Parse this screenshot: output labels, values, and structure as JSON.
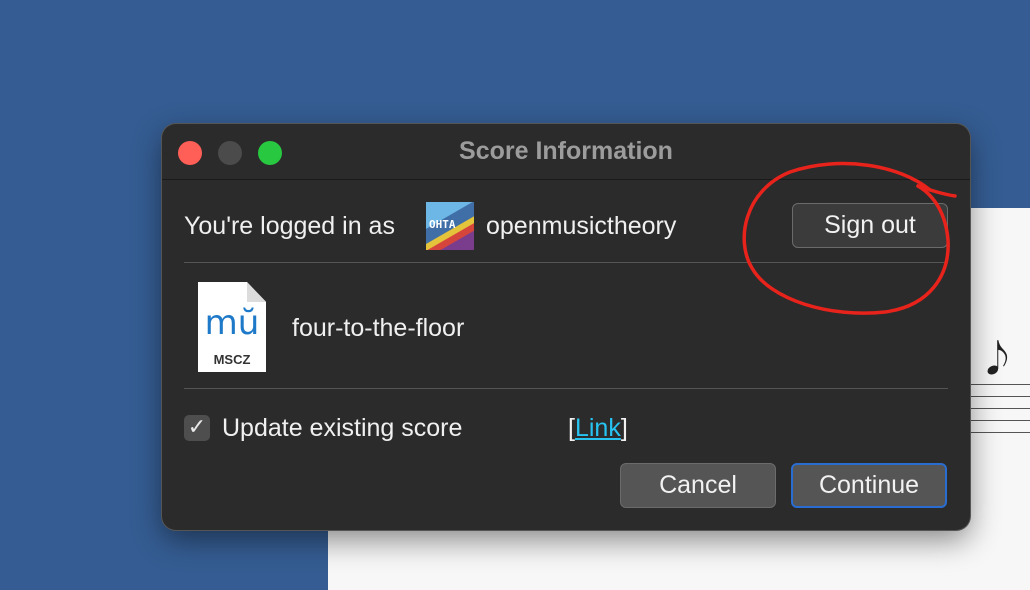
{
  "dialog": {
    "title": "Score Information",
    "logged_in_label": "You're logged in as",
    "avatar_text": "OHTA",
    "username": "openmusictheory",
    "sign_out_label": "Sign out",
    "file": {
      "icon_label": "MSCZ",
      "name": "four-to-the-floor"
    },
    "update_existing": {
      "checked": true,
      "check_glyph": "✓",
      "label": "Update existing score"
    },
    "link": {
      "open_bracket": "[",
      "label": "Link",
      "close_bracket": "]"
    },
    "cancel_label": "Cancel",
    "continue_label": "Continue"
  },
  "icons": {
    "close": "traffic-close",
    "minimize": "traffic-minimize",
    "maximize": "traffic-maximize",
    "file": "mscz-file-icon",
    "note": "eighth-note-icon"
  },
  "colors": {
    "desktop": "#355d93",
    "dialog_bg": "#2b2b2b",
    "link": "#27c4f2",
    "annotation": "#e8231c",
    "default_button_border": "#2a6dd1"
  }
}
